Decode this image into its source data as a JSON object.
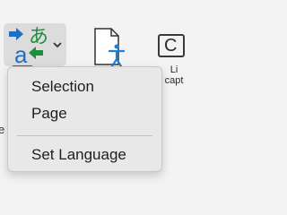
{
  "ribbon": {
    "translate_icon": "translate-icon",
    "dropdown_icon": "chevron-down-icon",
    "accessibility_icon": "accessibility-document-icon",
    "caption_icon_glyph": "C",
    "caption_label": "Li\ncapt"
  },
  "left_edge_text": "e",
  "menu": {
    "items": [
      {
        "label": "Selection"
      },
      {
        "label": "Page"
      },
      {
        "label": "Set Language"
      }
    ]
  }
}
